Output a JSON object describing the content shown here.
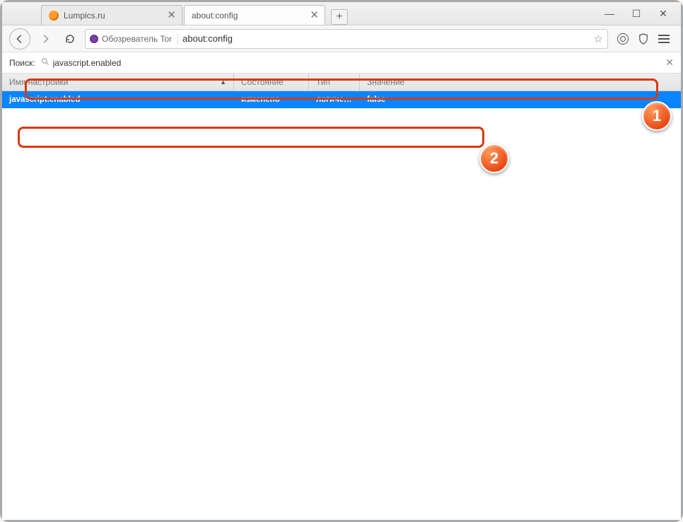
{
  "window": {
    "controls": {
      "min": "—",
      "max": "☐",
      "close": "✕"
    }
  },
  "tabs": {
    "items": [
      {
        "title": "Lumpics.ru",
        "active": false
      },
      {
        "title": "about:config",
        "active": true
      }
    ],
    "newtab_label": "+"
  },
  "navbar": {
    "tor_label": "Обозреватель Tor",
    "url": "about:config"
  },
  "search": {
    "label": "Поиск:",
    "value": "javascript.enabled",
    "clear_glyph": "✕"
  },
  "columns": {
    "name": "Имя настройки",
    "status": "Состояние",
    "type": "Тип",
    "value": "Значение",
    "sort_glyph": "▲"
  },
  "rows": [
    {
      "name": "javascript.enabled",
      "status": "изменено",
      "type": "логическ...",
      "value": "false"
    }
  ],
  "callouts": {
    "one": "1",
    "two": "2"
  }
}
